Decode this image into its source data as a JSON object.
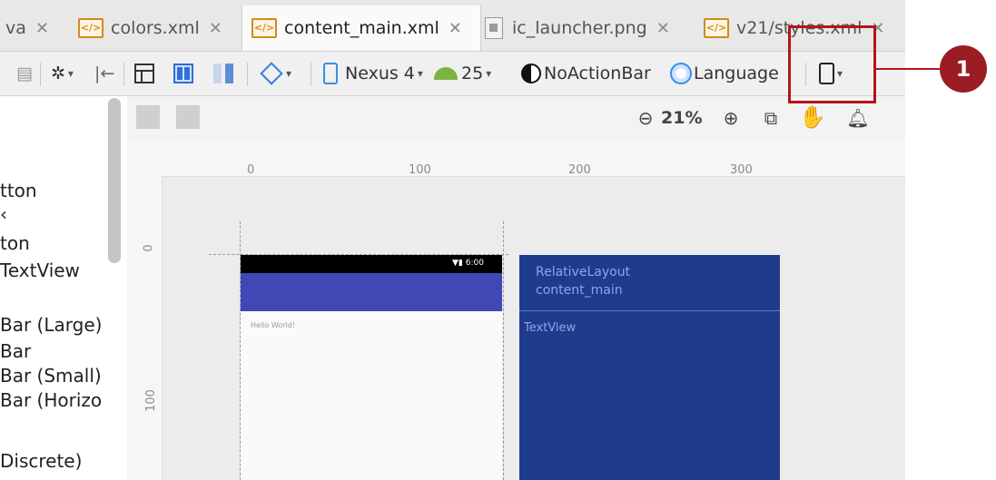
{
  "tabs": [
    {
      "label": "va",
      "active": false
    },
    {
      "label": "colors.xml",
      "active": false
    },
    {
      "label": "content_main.xml",
      "active": true
    },
    {
      "label": "ic_launcher.png",
      "active": false
    },
    {
      "label": "v21/styles.xml",
      "active": false
    }
  ],
  "toolbar": {
    "device": "Nexus 4",
    "api": "25",
    "theme": "NoActionBar",
    "language": "Language"
  },
  "zoom": {
    "level": "21%"
  },
  "palette": {
    "items": [
      "tton",
      "‹",
      "ton",
      "TextView",
      "Bar (Large)",
      "Bar",
      "Bar (Small)",
      "Bar (Horizo",
      "Discrete)"
    ]
  },
  "ruler": {
    "h_ticks": [
      "0",
      "100",
      "200",
      "300"
    ],
    "v_ticks": [
      "0",
      "100"
    ]
  },
  "preview": {
    "hello_text": "Hello World!",
    "status_time": "6:00"
  },
  "blueprint": {
    "layout_type": "RelativeLayout",
    "layout_id": "content_main",
    "child": "TextView"
  },
  "callout": {
    "number": "1"
  },
  "colors": {
    "callout": "#9b1c22",
    "appbar": "#3f48b5",
    "blueprint": "#1f3b8c"
  }
}
